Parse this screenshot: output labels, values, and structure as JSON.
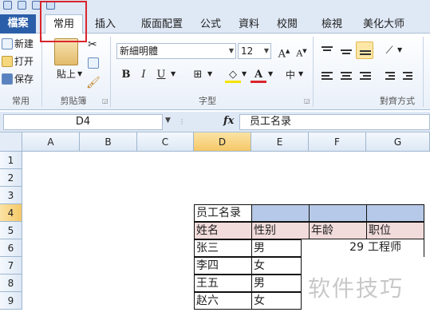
{
  "ribbon_tabs": [
    "檔案",
    "常用",
    "插入",
    "版面配置",
    "公式",
    "資料",
    "校閱",
    "檢視",
    "美化大师"
  ],
  "clipboard": {
    "new_label": "新建",
    "open_label": "打开",
    "save_label": "保存",
    "group_common": "常用",
    "paste_label": "貼上",
    "group_clipboard": "剪貼簿"
  },
  "font": {
    "name": "新細明體",
    "size": "12",
    "bold": "B",
    "italic": "I",
    "underline": "U",
    "font_color_glyph": "A",
    "group_label": "字型"
  },
  "alignment": {
    "group_label": "對齊方式"
  },
  "formula_bar": {
    "cell_ref": "D4",
    "fx": "fx",
    "content": "员工名录"
  },
  "columns": [
    "A",
    "B",
    "C",
    "D",
    "E",
    "F",
    "G"
  ],
  "selected_column": "D",
  "rows": [
    "1",
    "2",
    "3",
    "4",
    "5",
    "6",
    "7",
    "8",
    "9"
  ],
  "selected_row": "4",
  "sheet": {
    "title": "员工名录",
    "headers": [
      "姓名",
      "性别",
      "年龄",
      "职位"
    ],
    "records": [
      {
        "name": "张三",
        "gender": "男",
        "age": "29",
        "position": "工程师"
      },
      {
        "name": "李四",
        "gender": "女"
      },
      {
        "name": "王五",
        "gender": "男"
      },
      {
        "name": "赵六",
        "gender": "女"
      }
    ]
  },
  "watermark": "软件技巧",
  "colors": {
    "file_tab": "#2b5ea8",
    "highlight_box": "#d9262c",
    "title_fill": "#b7c9e8",
    "header_fill": "#f2dbdb",
    "selected_header": "#f5c867"
  }
}
